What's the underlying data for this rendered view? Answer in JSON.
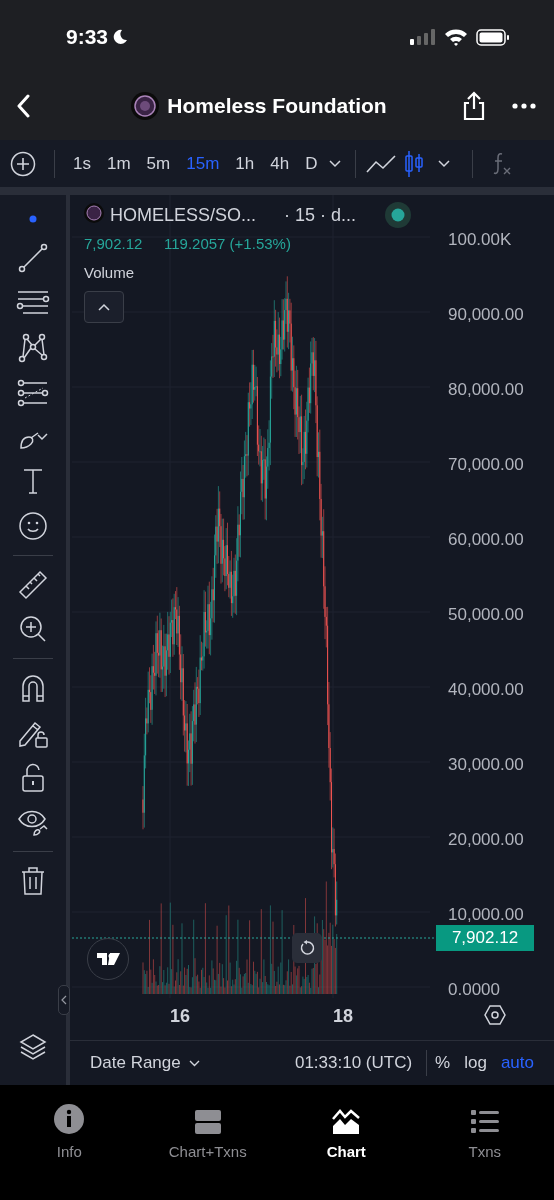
{
  "status_bar": {
    "time": "9:33"
  },
  "header": {
    "title": "Homeless Foundation"
  },
  "toolbar": {
    "intervals": [
      {
        "label": "1s",
        "selected": false
      },
      {
        "label": "1m",
        "selected": false
      },
      {
        "label": "5m",
        "selected": false
      },
      {
        "label": "15m",
        "selected": true
      },
      {
        "label": "1h",
        "selected": false
      },
      {
        "label": "4h",
        "selected": false
      },
      {
        "label": "D",
        "selected": false
      }
    ],
    "chart_styles": [
      {
        "kind": "line",
        "selected": false
      },
      {
        "kind": "candles",
        "selected": true
      }
    ]
  },
  "legend": {
    "symbol": "HOMELESS/SO...",
    "interval": "· 15 · d...",
    "price": "7,902.12",
    "change": "119.2057 (+1.53%)",
    "indicator": "Volume"
  },
  "y_axis": [
    "100.00K",
    "90,000.00",
    "80,000.00",
    "70,000.00",
    "60,000.00",
    "50,000.00",
    "40,000.00",
    "30,000.00",
    "20,000.00",
    "10,000.00",
    "0.0000"
  ],
  "price_tag": "7,902.12",
  "x_axis": [
    "16",
    "18"
  ],
  "bottom_bar": {
    "date_range": "Date Range",
    "time": "01:33:10 (UTC)",
    "options": [
      {
        "label": "%",
        "selected": false
      },
      {
        "label": "log",
        "selected": false
      },
      {
        "label": "auto",
        "selected": true
      }
    ]
  },
  "tab_bar": [
    {
      "label": "Info",
      "selected": false
    },
    {
      "label": "Chart+Txns",
      "selected": false
    },
    {
      "label": "Chart",
      "selected": true
    },
    {
      "label": "Txns",
      "selected": false
    }
  ]
}
